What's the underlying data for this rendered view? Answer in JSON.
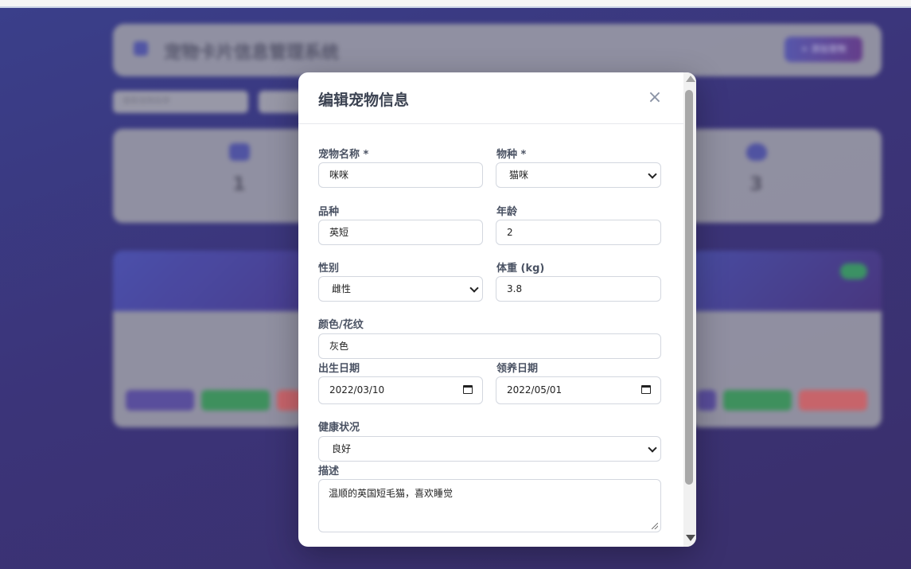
{
  "background": {
    "app_title": "宠物卡片信息管理系统",
    "add_button": "+ 添加宠物",
    "search_placeholder": "搜索宠物名称",
    "stat_left_value": "1",
    "stat_right_value": "3"
  },
  "modal": {
    "title": "编辑宠物信息",
    "close_symbol": "×",
    "fields": {
      "name": {
        "label": "宠物名称",
        "required": "*",
        "value": "咪咪"
      },
      "species": {
        "label": "物种",
        "required": "*",
        "value": "猫咪"
      },
      "breed": {
        "label": "品种",
        "value": "英短"
      },
      "age": {
        "label": "年龄",
        "value": "2"
      },
      "gender": {
        "label": "性别",
        "value": "雌性"
      },
      "weight": {
        "label": "体重 (kg)",
        "value": "3.8"
      },
      "color": {
        "label": "颜色/花纹",
        "value": "灰色"
      },
      "birth_date": {
        "label": "出生日期",
        "value": "2022/03/10"
      },
      "adopt_date": {
        "label": "领养日期",
        "value": "2022/05/01"
      },
      "health": {
        "label": "健康状况",
        "value": "良好"
      },
      "description": {
        "label": "描述",
        "value": "温顺的英国短毛猫，喜欢睡觉"
      }
    }
  },
  "colors": {
    "backdrop": "#3b3479",
    "label": "#4a5263",
    "border": "#d3d7df"
  }
}
